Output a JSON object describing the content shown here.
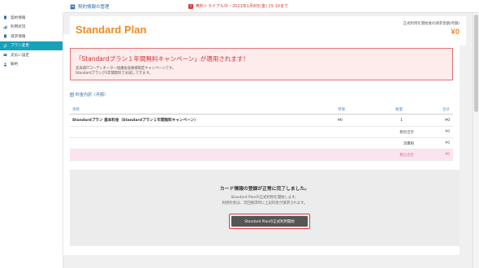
{
  "header": {
    "title": "契約情報の管理",
    "trial_text": "無料トライアル中・2021年1月8日(金) 15:10まで"
  },
  "sidebar": {
    "items": [
      {
        "label": "契約情報",
        "icon": "document-icon",
        "active": false
      },
      {
        "label": "利用状況",
        "icon": "chart-icon",
        "active": false
      },
      {
        "label": "請求情報",
        "icon": "document-icon",
        "active": false
      },
      {
        "label": "プラン変更",
        "icon": "swap-icon",
        "active": true
      },
      {
        "label": "支払い設定",
        "icon": "card-icon",
        "active": false
      },
      {
        "label": "解約",
        "icon": "user-icon",
        "active": false
      }
    ]
  },
  "plan": {
    "name": "Standard Plan",
    "price_label": "正式利用を開始後の請求金額(月額)",
    "price": "¥0"
  },
  "campaign": {
    "title": "「Standardプラン１年間無料キャンペーン」が適用されます！",
    "line1": "北海道ITコーディネーター協議会会員様限定キャンペーンです。",
    "line2": "Standardプランが1年間無料でお試しできます。"
  },
  "fee_section": {
    "title": "料金内訳（月額）",
    "headers": [
      "項目",
      "単価",
      "数量",
      "合計"
    ],
    "items": [
      {
        "name": "Standardプラン 基本料金（Standardプラン１年間無料キャンペーン）",
        "unit": "¥0",
        "qty": "1",
        "total": "¥0"
      }
    ],
    "summary": [
      {
        "label": "税別合計",
        "value": "¥0",
        "highlight": false
      },
      {
        "label": "消費税",
        "value": "¥0",
        "highlight": false
      },
      {
        "label": "税込合計",
        "value": "¥0",
        "highlight": true
      }
    ]
  },
  "complete": {
    "title": "カード情報の登録が正常に完了しました。",
    "line1": "Standard Planの正式利用を開始します。",
    "line2": "利用料金は、次回請求時に上記料金が請求されます。",
    "button_label": "Standard Planの正式利用開始"
  },
  "colors": {
    "accent": "#17a2b8",
    "plan_orange": "#f08a24",
    "alert_red": "#d32f2f",
    "link_blue": "#2b6ea8"
  }
}
